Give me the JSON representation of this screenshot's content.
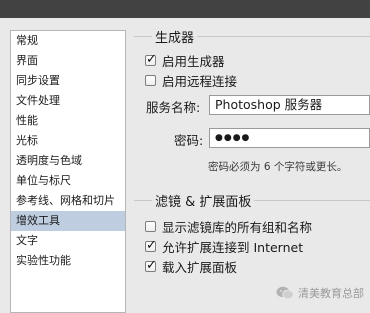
{
  "nav": {
    "items": [
      {
        "label": "常规"
      },
      {
        "label": "界面"
      },
      {
        "label": "同步设置"
      },
      {
        "label": "文件处理"
      },
      {
        "label": "性能"
      },
      {
        "label": "光标"
      },
      {
        "label": "透明度与色域"
      },
      {
        "label": "单位与标尺"
      },
      {
        "label": "参考线、网格和切片"
      },
      {
        "label": "增效工具"
      },
      {
        "label": "文字"
      },
      {
        "label": "实验性功能"
      }
    ],
    "selected_index": 9
  },
  "generator": {
    "title": "生成器",
    "enable_generator": {
      "label": "启用生成器",
      "checked": true
    },
    "enable_remote": {
      "label": "启用远程连接",
      "checked": false
    },
    "service_name_label": "服务名称:",
    "service_name_value": "Photoshop 服务器",
    "password_label": "密码:",
    "password_value": "●●●●",
    "password_hint": "密码必须为 6 个字符或更长。"
  },
  "filters": {
    "title": "滤镜 & 扩展面板",
    "show_all_filters": {
      "label": "显示滤镜库的所有组和名称",
      "checked": false
    },
    "allow_internet": {
      "label": "允许扩展连接到 Internet",
      "checked": true
    },
    "load_extensions": {
      "label": "载入扩展面板",
      "checked": true
    }
  },
  "watermark": {
    "text": "清美教育总部"
  },
  "colors": {
    "selected": "#bfcde0",
    "background": "#e9e9e9"
  }
}
